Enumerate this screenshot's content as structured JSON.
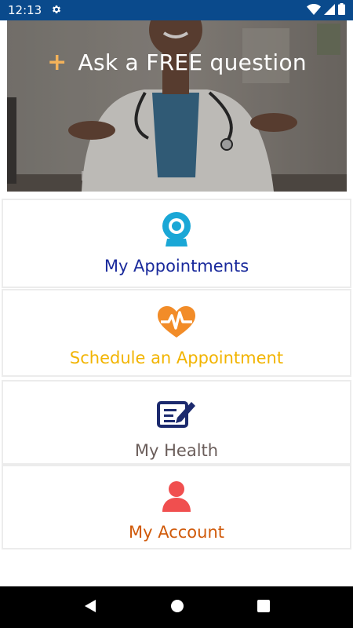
{
  "status_bar": {
    "time": "12:13",
    "icons": [
      "gear-icon",
      "wifi-icon",
      "signal-icon",
      "battery-icon"
    ],
    "color": "#0a4a8c"
  },
  "hero": {
    "cta_plus": "+",
    "cta_text": "Ask a FREE question"
  },
  "menu": {
    "appointments": {
      "label": "My Appointments",
      "icon": "webcam-icon",
      "color": "#1a2a9c"
    },
    "schedule": {
      "label": "Schedule an Appointment",
      "icon": "heartbeat-icon",
      "color": "#f2b400"
    },
    "health": {
      "label": "My Health",
      "icon": "notepad-edit-icon",
      "color": "#6a5d5a"
    },
    "account": {
      "label": "My Account",
      "icon": "user-icon",
      "color": "#d05a0a"
    }
  },
  "nav_bar": {
    "icons": [
      "back-icon",
      "home-icon",
      "recents-icon"
    ]
  }
}
